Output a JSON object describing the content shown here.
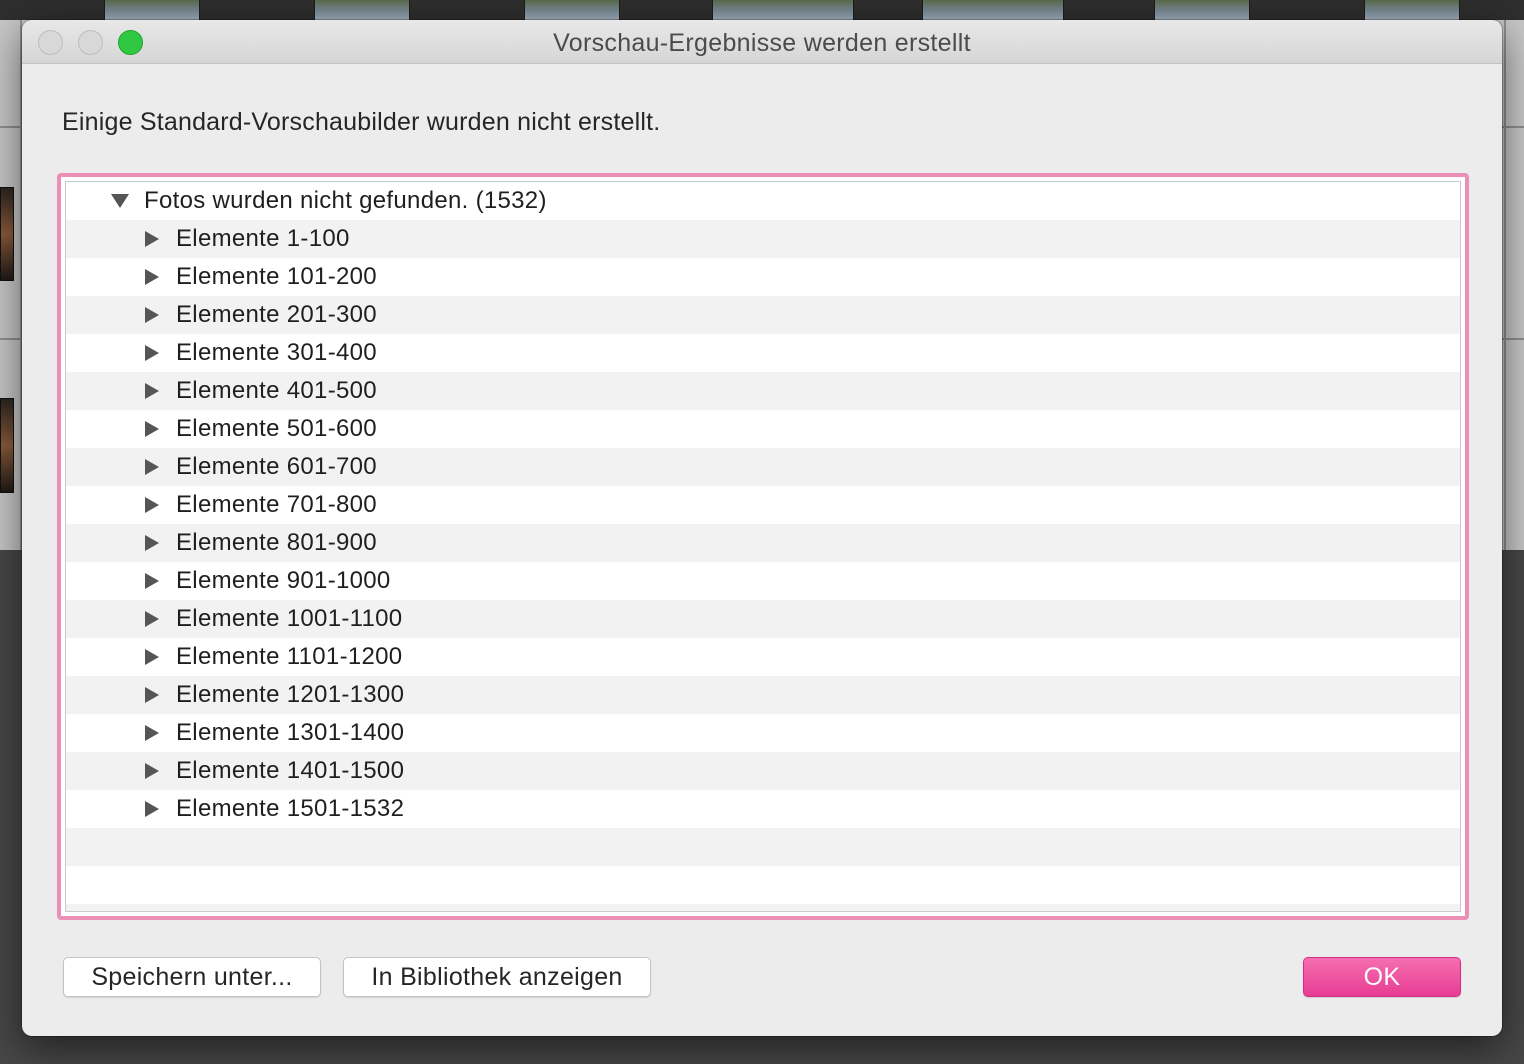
{
  "dialog": {
    "title": "Vorschau-Ergebnisse werden erstellt",
    "message": "Einige Standard-Vorschaubilder wurden nicht erstellt.",
    "tree": {
      "parent": {
        "label": "Fotos wurden nicht gefunden. (1532)",
        "expanded": true
      },
      "children": [
        {
          "label": "Elemente 1-100"
        },
        {
          "label": "Elemente 101-200"
        },
        {
          "label": "Elemente 201-300"
        },
        {
          "label": "Elemente 301-400"
        },
        {
          "label": "Elemente 401-500"
        },
        {
          "label": "Elemente 501-600"
        },
        {
          "label": "Elemente 601-700"
        },
        {
          "label": "Elemente 701-800"
        },
        {
          "label": "Elemente 801-900"
        },
        {
          "label": "Elemente 901-1000"
        },
        {
          "label": "Elemente 1001-1100"
        },
        {
          "label": "Elemente 1101-1200"
        },
        {
          "label": "Elemente 1201-1300"
        },
        {
          "label": "Elemente 1301-1400"
        },
        {
          "label": "Elemente 1401-1500"
        },
        {
          "label": "Elemente 1501-1532"
        }
      ]
    },
    "buttons": {
      "save_as": "Speichern unter...",
      "show_in_library": "In Bibliothek anzeigen",
      "ok": "OK"
    }
  },
  "colors": {
    "accent": "#e83c94",
    "list_highlight_border": "#ec8fb7",
    "zoom_button": "#2fc840"
  },
  "icons": {
    "collapsed": "disclosure-triangle-right-icon",
    "expanded": "disclosure-triangle-down-icon"
  }
}
